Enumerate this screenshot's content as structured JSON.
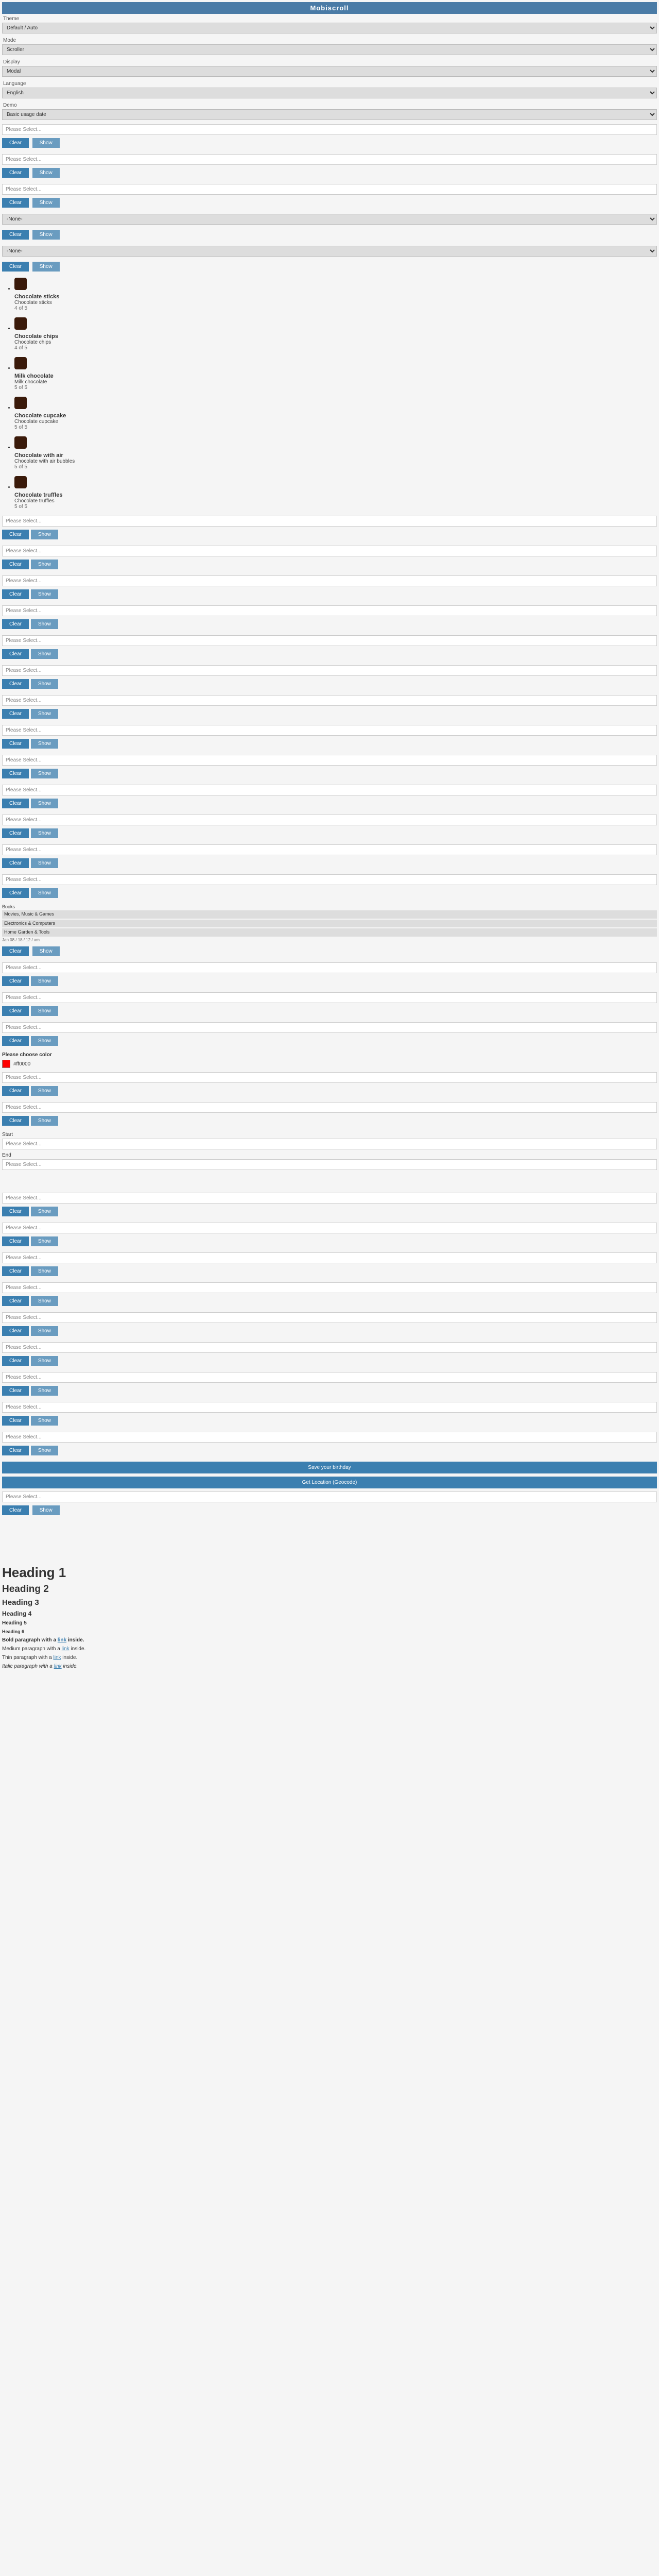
{
  "title": "Mobiscroll",
  "dropdowns": {
    "theme": {
      "label": "Theme",
      "value": "Default / Auto"
    },
    "mode": {
      "label": "Mode",
      "value": "Scroller"
    },
    "display": {
      "label": "Display",
      "value": "Modal"
    },
    "language": {
      "label": "Language",
      "value": "English"
    },
    "demo": {
      "label": "Demo",
      "value": "Basic usage date"
    }
  },
  "placeholder": "Please Select...",
  "btn_clear": "Clear",
  "btn_show": "Show",
  "generic_select_value": "-None-",
  "chocolates": [
    {
      "title": "Chocolate sticks",
      "desc": "Chocolate sticks",
      "rating": "4 of 5"
    },
    {
      "title": "Chocolate chips",
      "desc": "Chocolate chips",
      "rating": "4 of 5"
    },
    {
      "title": "Milk chocolate",
      "desc": "Milk chocolate",
      "rating": "5 of 5"
    },
    {
      "title": "Chocolate cupcake",
      "desc": "Chocolate cupcake",
      "rating": "5 of 5"
    },
    {
      "title": "Chocolate with air",
      "desc": "Chocolate with air bubbles",
      "rating": "5 of 5"
    },
    {
      "title": "Chocolate truffles",
      "desc": "Chocolate truffles",
      "rating": "5 of 5"
    }
  ],
  "books": {
    "header": "Books",
    "lines": [
      "Movies, Music & Games",
      "Electronics & Computers",
      "Home Garden & Tools"
    ],
    "footer": "Jan 08 / 18 / 12 / am"
  },
  "color": {
    "label": "Please choose color",
    "value": "#ff0000"
  },
  "range": {
    "start_label": "Start",
    "end_label": "End"
  },
  "wide_buttons": {
    "birthday": "Save your birthday",
    "location": "Get Location (Geocode)"
  },
  "headings": {
    "h1": "Heading 1",
    "h2": "Heading 2",
    "h3": "Heading 3",
    "h4": "Heading 4",
    "h5": "Heading 5",
    "h6": "Heading 6"
  },
  "paragraphs": {
    "bold": {
      "prefix": "Bold paragraph with a ",
      "link": "link",
      "suffix": " inside."
    },
    "medium": {
      "prefix": "Medium paragraph with a ",
      "link": "link",
      "suffix": " inside."
    },
    "thin": {
      "prefix": "Thin paragraph with a ",
      "link": "link",
      "suffix": " inside."
    },
    "italic": {
      "prefix": "Italic paragraph with a ",
      "link": "link",
      "suffix": " inside."
    }
  }
}
